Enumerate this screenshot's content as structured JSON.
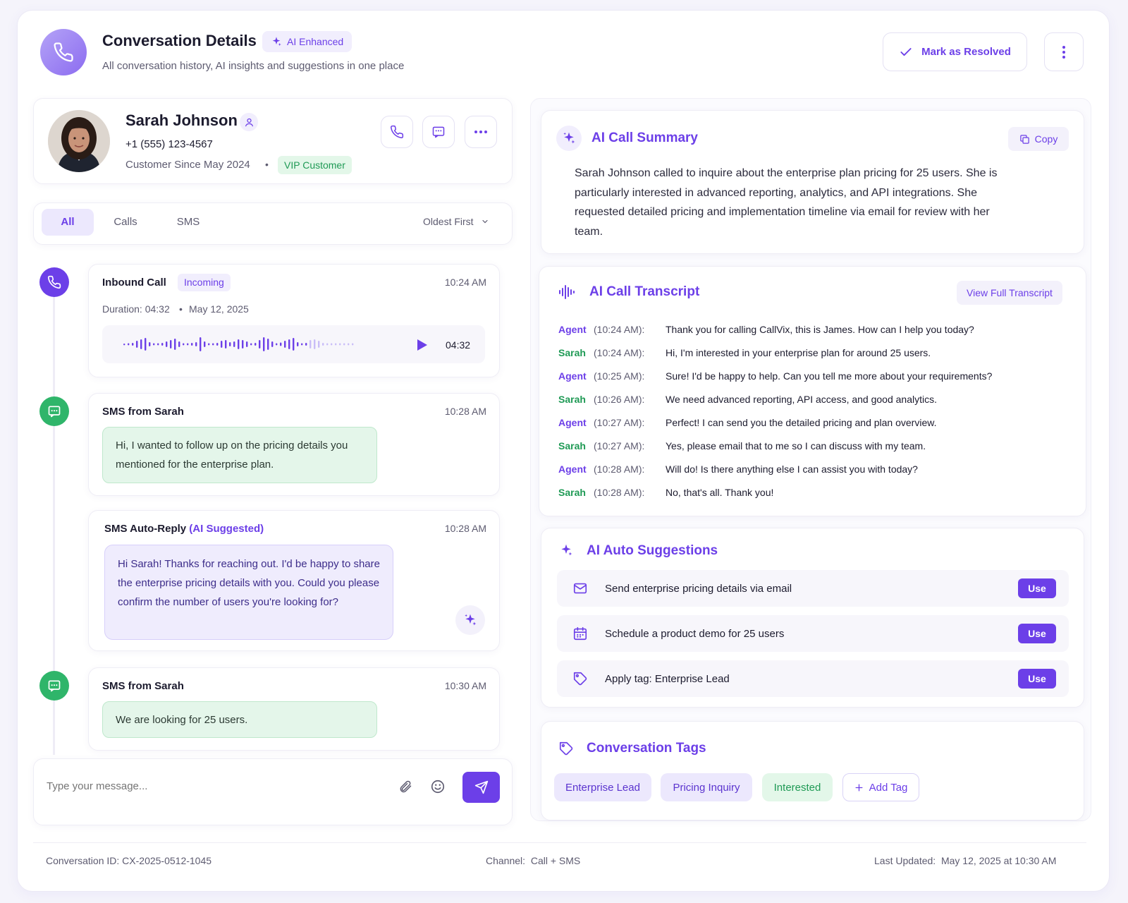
{
  "header": {
    "title": "Conversation Details",
    "ai_badge": "AI Enhanced",
    "subtitle": "All conversation history, AI insights and suggestions in one place",
    "resolve_label": "Mark as Resolved"
  },
  "contact": {
    "name": "Sarah Johnson",
    "phone": "+1 (555) 123-4567",
    "since": "Customer Since May 2024",
    "separator": "•",
    "vip_label": "VIP Customer"
  },
  "filters": {
    "tabs": [
      "All",
      "Calls",
      "SMS"
    ],
    "active_tab": "All",
    "sort_label": "Oldest First"
  },
  "timeline": {
    "call": {
      "title": "Inbound Call",
      "badge": "Incoming",
      "time": "10:24 AM",
      "meta": "Duration: 04:32",
      "separator": "•",
      "date": "May 12, 2025",
      "audio_duration": "04:32"
    },
    "sms1": {
      "title": "SMS from Sarah",
      "time": "10:28 AM",
      "text": "Hi, I wanted to follow up on the pricing details you mentioned for the enterprise plan."
    },
    "auto_reply": {
      "title": "SMS Auto-Reply",
      "tag": "(AI Suggested)",
      "time": "10:28 AM",
      "text": "Hi Sarah! Thanks for reaching out. I'd be happy to share the enterprise pricing details with you. Could you please confirm the number of users you're looking for?"
    },
    "sms2": {
      "title": "SMS from Sarah",
      "time": "10:30 AM",
      "text": "We are looking for 25 users."
    }
  },
  "composer": {
    "placeholder": "Type your message..."
  },
  "summary": {
    "title": "AI Call Summary",
    "copy_label": "Copy",
    "text": "Sarah Johnson called to inquire about the enterprise plan pricing for 25 users. She is particularly interested in advanced reporting, analytics, and API integrations. She requested detailed pricing and implementation timeline via email for review with her team."
  },
  "transcript": {
    "title": "AI Call Transcript",
    "view_full_label": "View Full Transcript",
    "lines": [
      {
        "speaker": "Agent",
        "time": "(10:24 AM):",
        "text": "Thank you for calling CallVix, this is James. How can I help you today?"
      },
      {
        "speaker": "Sarah",
        "time": "(10:24 AM):",
        "text": "Hi, I'm interested in your enterprise plan for around 25 users."
      },
      {
        "speaker": "Agent",
        "time": "(10:25 AM):",
        "text": "Sure! I'd be happy to help. Can you tell me more about your requirements?"
      },
      {
        "speaker": "Sarah",
        "time": "(10:26 AM):",
        "text": "We need advanced reporting, API access, and good analytics."
      },
      {
        "speaker": "Agent",
        "time": "(10:27 AM):",
        "text": "Perfect! I can send you the detailed pricing and plan overview."
      },
      {
        "speaker": "Sarah",
        "time": "(10:27 AM):",
        "text": "Yes, please email that to me so I can discuss with my team."
      },
      {
        "speaker": "Agent",
        "time": "(10:28 AM):",
        "text": "Will do! Is there anything else I can assist you with today?"
      },
      {
        "speaker": "Sarah",
        "time": "(10:28 AM):",
        "text": "No, that's all.  Thank you!"
      }
    ]
  },
  "suggestions": {
    "title": "AI Auto Suggestions",
    "items": [
      {
        "icon": "mail-icon",
        "text": "Send enterprise pricing details via email",
        "action": "Use"
      },
      {
        "icon": "calendar-icon",
        "text": "Schedule a product demo for 25 users",
        "action": "Use"
      },
      {
        "icon": "tag-icon",
        "text": "Apply tag: Enterprise Lead",
        "action": "Use"
      }
    ]
  },
  "tags": {
    "title": "Conversation Tags",
    "items": [
      "Enterprise Lead",
      "Pricing Inquiry",
      "Interested"
    ],
    "add_label": "Add Tag"
  },
  "footer": {
    "conversation_id_label": "Conversation ID:",
    "conversation_id": "CX-2025-0512-1045",
    "channel_label": "Channel:",
    "channel": "Call + SMS",
    "updated_label": "Last Updated:",
    "updated": "May 12, 2025 at 10:30 AM"
  },
  "colors": {
    "accent": "#6c3fe8",
    "sms_green": "#1f9a55",
    "vip_bg": "#e3f7e9"
  }
}
